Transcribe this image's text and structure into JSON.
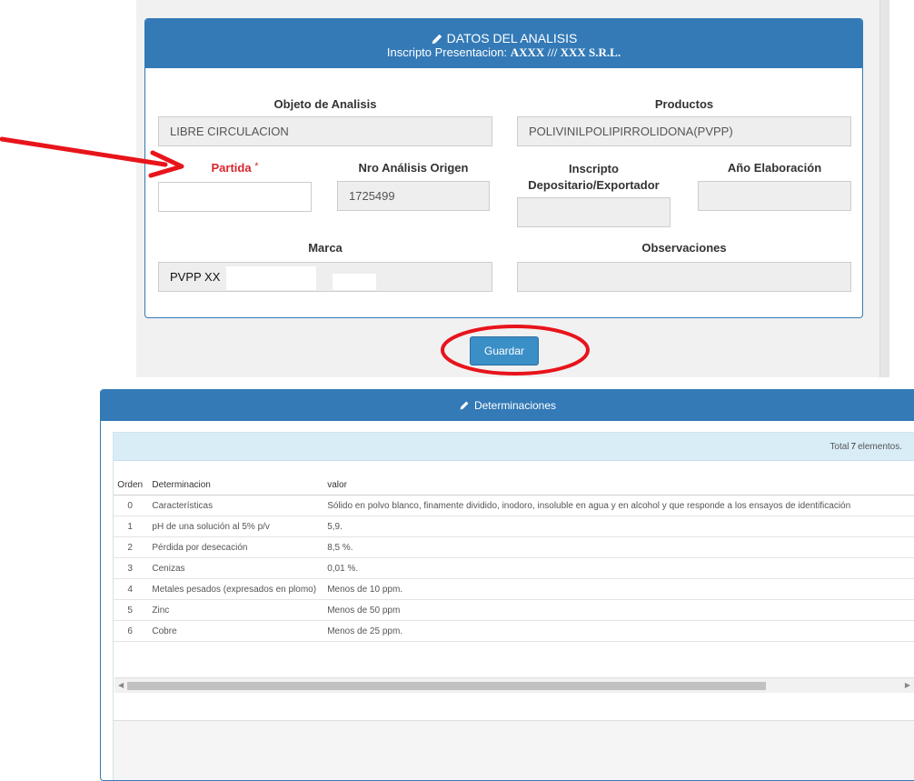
{
  "analysis": {
    "title": "DATOS DEL ANALISIS",
    "subtitle_prefix": "Inscripto Presentacion:",
    "subtitle_value": "AXXX /// XXX S.R.L.",
    "objeto_label": "Objeto de Analisis",
    "objeto_value": "LIBRE CIRCULACION",
    "productos_label": "Productos",
    "productos_value": "POLIVINILPOLIPIRROLIDONA(PVPP)",
    "partida_label": "Partida",
    "partida_required": "*",
    "partida_value": "",
    "nro_label": "Nro Análisis Origen",
    "nro_value": "1725499",
    "inscripto_label_1": "Inscripto",
    "inscripto_label_2": "Depositario/Exportador",
    "inscripto_value": "",
    "anio_label": "Año Elaboración",
    "anio_value": "",
    "marca_label": "Marca",
    "marca_value": "PVPP XX",
    "observaciones_label": "Observaciones",
    "observaciones_value": ""
  },
  "save_button": "Guardar",
  "determinaciones": {
    "title": "Determinaciones",
    "total_prefix": "Total",
    "total_count": "7",
    "total_suffix": "elementos.",
    "columns": [
      "Orden",
      "Determinacion",
      "valor"
    ],
    "rows": [
      [
        "0",
        "Características",
        "Sólido en polvo blanco, finamente dividido, inodoro, insoluble en agua y en alcohol y que responde a los ensayos de identificación"
      ],
      [
        "1",
        "pH de una solución al 5% p/v",
        "5,9."
      ],
      [
        "2",
        "Pérdida por desecación",
        "8,5 %."
      ],
      [
        "3",
        "Cenizas",
        "0,01 %."
      ],
      [
        "4",
        "Metales pesados (expresados en plomo)",
        "Menos de 10 ppm."
      ],
      [
        "5",
        "Zinc",
        "Menos de 50 ppm"
      ],
      [
        "6",
        "Cobre",
        "Menos de 25 ppm."
      ]
    ]
  },
  "colors": {
    "primary": "#337ab7",
    "annotation": "#e8141b",
    "required": "#d9262c"
  }
}
